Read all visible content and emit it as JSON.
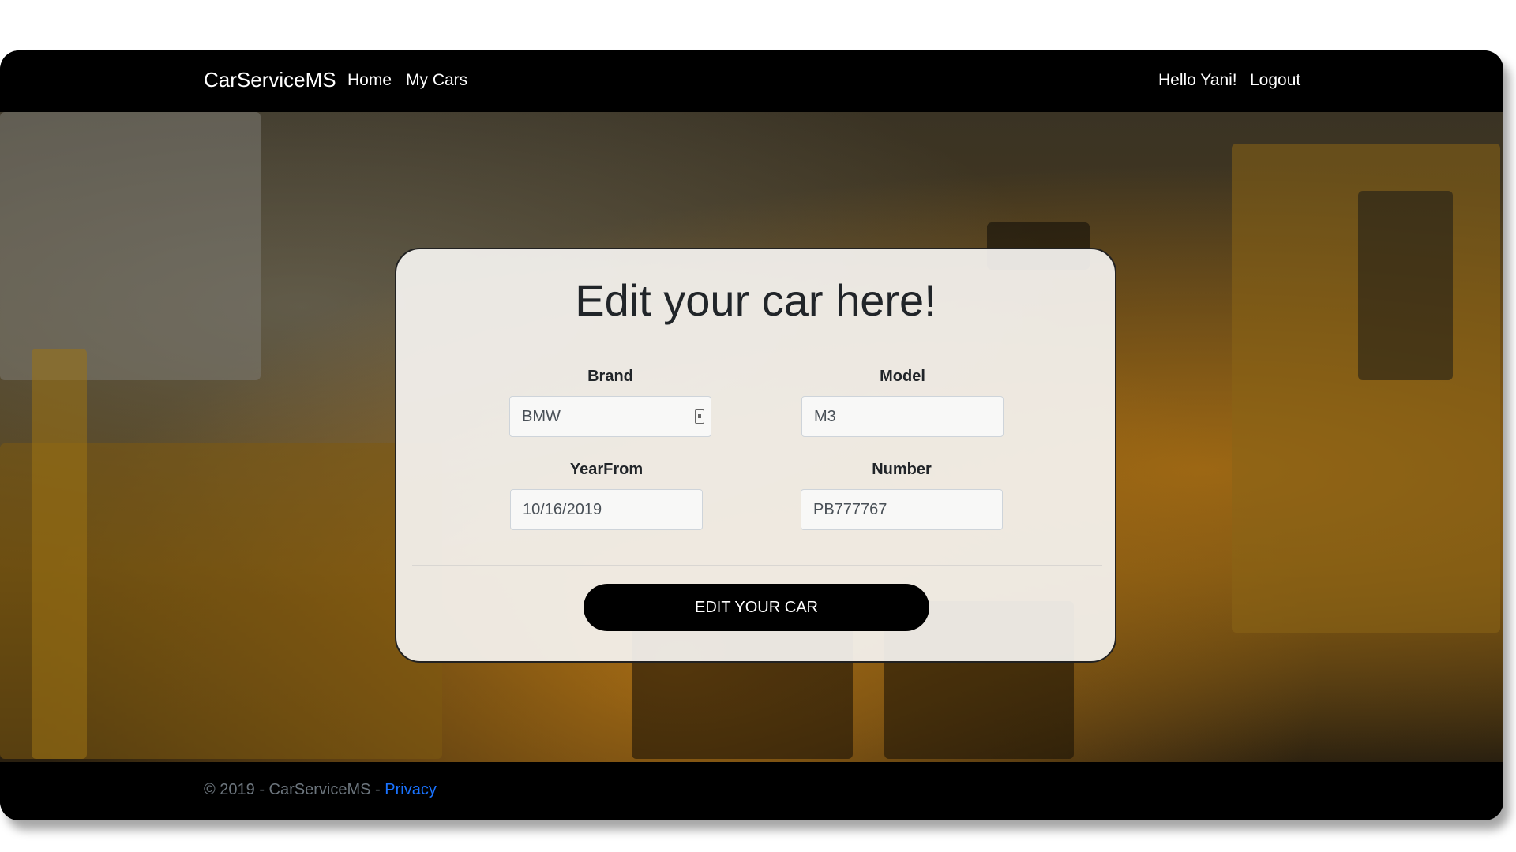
{
  "navbar": {
    "brand": "CarServiceMS",
    "links": [
      {
        "label": "Home"
      },
      {
        "label": "My Cars"
      }
    ],
    "greeting": "Hello Yani!",
    "logout": "Logout"
  },
  "form": {
    "title": "Edit your car here!",
    "fields": {
      "brand": {
        "label": "Brand",
        "value": "BMW"
      },
      "model": {
        "label": "Model",
        "value": "M3"
      },
      "year_from": {
        "label": "YearFrom",
        "value": "10/16/2019"
      },
      "number": {
        "label": "Number",
        "value": "PB777767"
      }
    },
    "submit_label": "EDIT YOUR CAR"
  },
  "footer": {
    "text": "© 2019 - CarServiceMS - ",
    "privacy_link": "Privacy"
  },
  "colors": {
    "navbar_bg": "#000000",
    "button_bg": "#000000",
    "link": "#1a73ff"
  },
  "icons": [
    "autofill-contact-icon"
  ]
}
